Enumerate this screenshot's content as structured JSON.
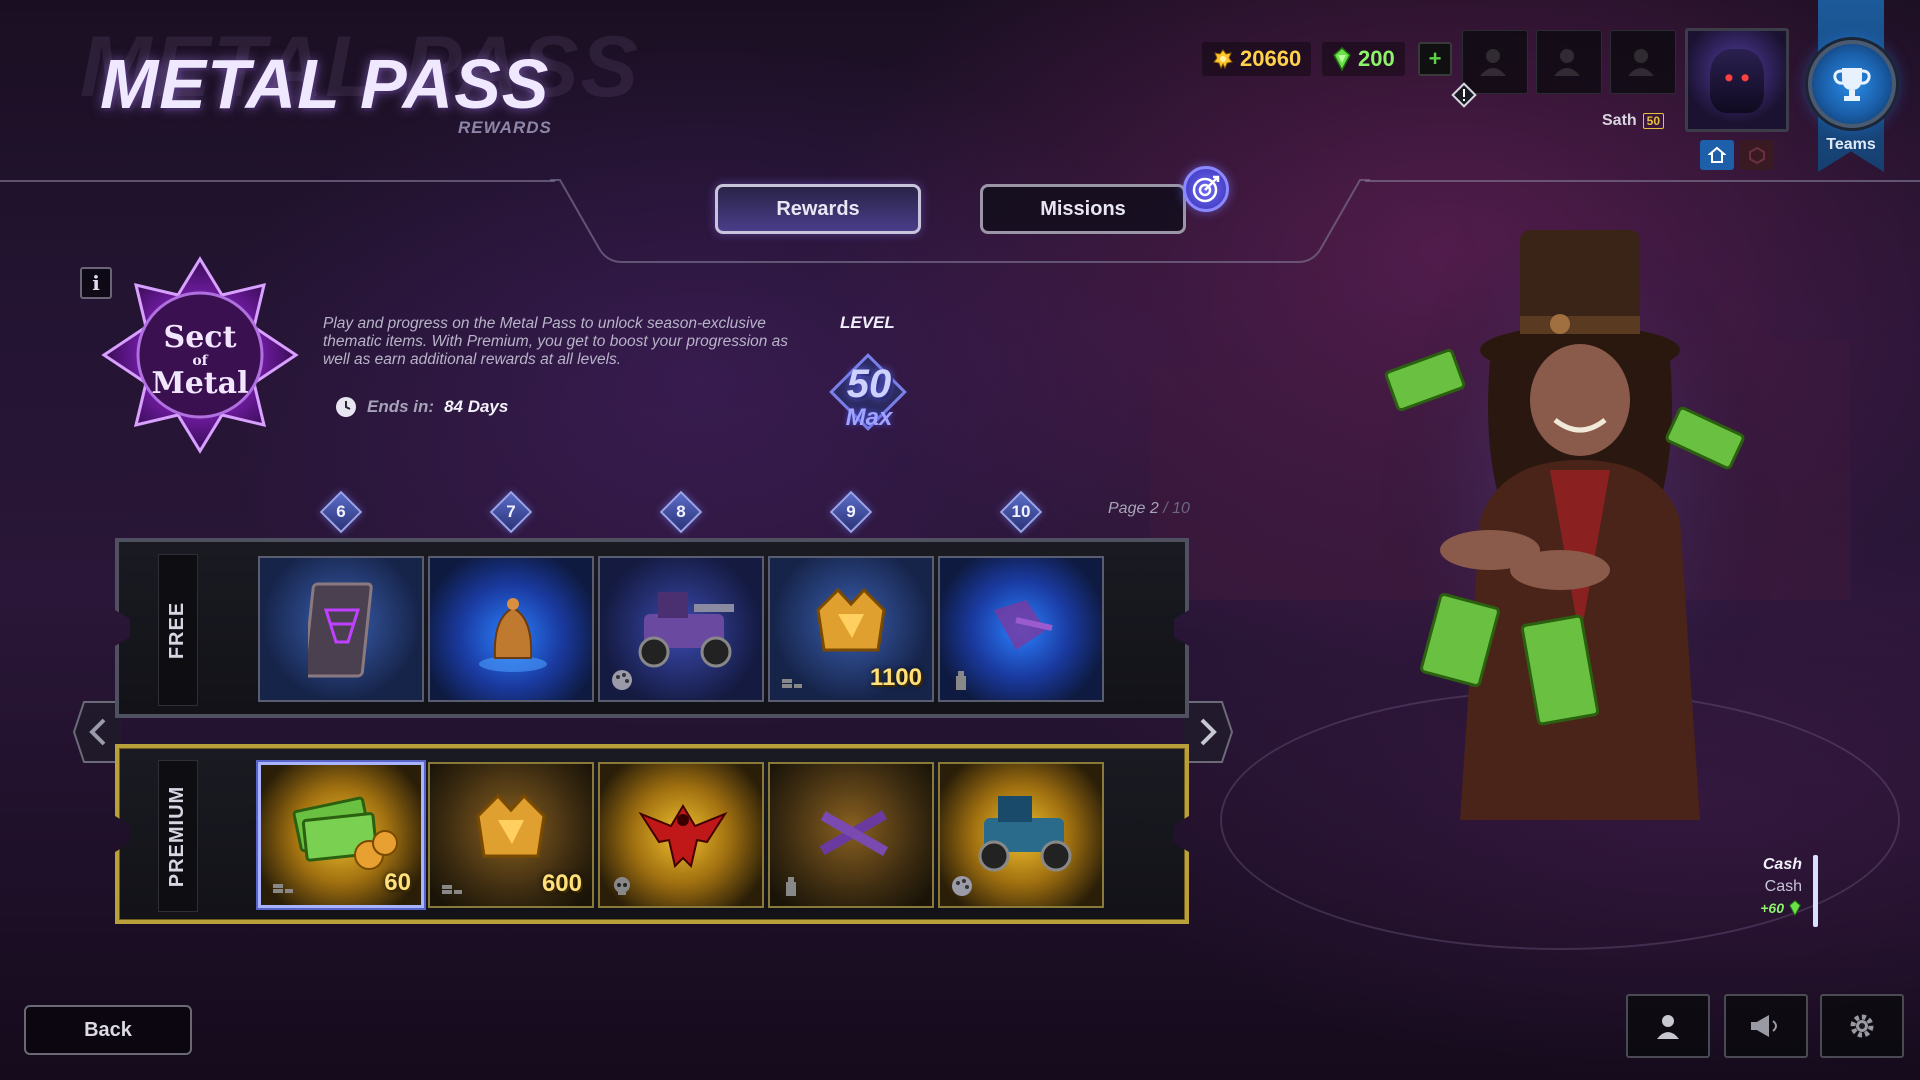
{
  "header": {
    "title": "METAL PASS",
    "title_ghost": "METAL PASS",
    "subtitle": "REWARDS"
  },
  "currency": {
    "gold": "20660",
    "green": "200",
    "add_label": "+"
  },
  "player": {
    "name": "Sath",
    "level": "50"
  },
  "teams": {
    "label": "Teams"
  },
  "tabs": [
    {
      "label": "Rewards",
      "active": true
    },
    {
      "label": "Missions",
      "active": false
    }
  ],
  "season": {
    "emblem_text": [
      "Sect",
      "of",
      "Metal"
    ],
    "info_label": "i",
    "description": "Play and progress on the Metal Pass to unlock season-exclusive thematic items. With Premium, you get to boost your progression as well as earn additional rewards at all levels.",
    "ends_label": "Ends in:",
    "ends_value": "84 Days"
  },
  "level": {
    "label": "LEVEL",
    "value": "50",
    "max_label": "Max"
  },
  "pagination": {
    "label": "Page",
    "current": "2",
    "total": "/ 10"
  },
  "level_markers": [
    "6",
    "7",
    "8",
    "9",
    "10"
  ],
  "tracks": {
    "free": {
      "label": "FREE",
      "rewards": [
        {
          "icon": "banner-icon",
          "qty": ""
        },
        {
          "icon": "bell-icon",
          "qty": ""
        },
        {
          "icon": "vehicle-icon",
          "qty": ""
        },
        {
          "icon": "gold-crown-icon",
          "qty": "1100"
        },
        {
          "icon": "spray-icon",
          "qty": ""
        }
      ]
    },
    "premium": {
      "label": "PREMIUM",
      "rewards": [
        {
          "icon": "cash-icon",
          "qty": "60"
        },
        {
          "icon": "gold-crown-icon",
          "qty": "600"
        },
        {
          "icon": "phoenix-decal-icon",
          "qty": ""
        },
        {
          "icon": "crossed-guns-icon",
          "qty": ""
        },
        {
          "icon": "vehicle-icon",
          "qty": ""
        }
      ]
    }
  },
  "selected_reward": {
    "title": "Cash",
    "subtitle": "Cash",
    "bonus": "+60"
  },
  "footer": {
    "back_label": "Back"
  },
  "colors": {
    "gold": "#ffd24a",
    "green": "#8cf36a",
    "premium_border": "#b9a03a",
    "accent_blue": "#5a64c8"
  }
}
